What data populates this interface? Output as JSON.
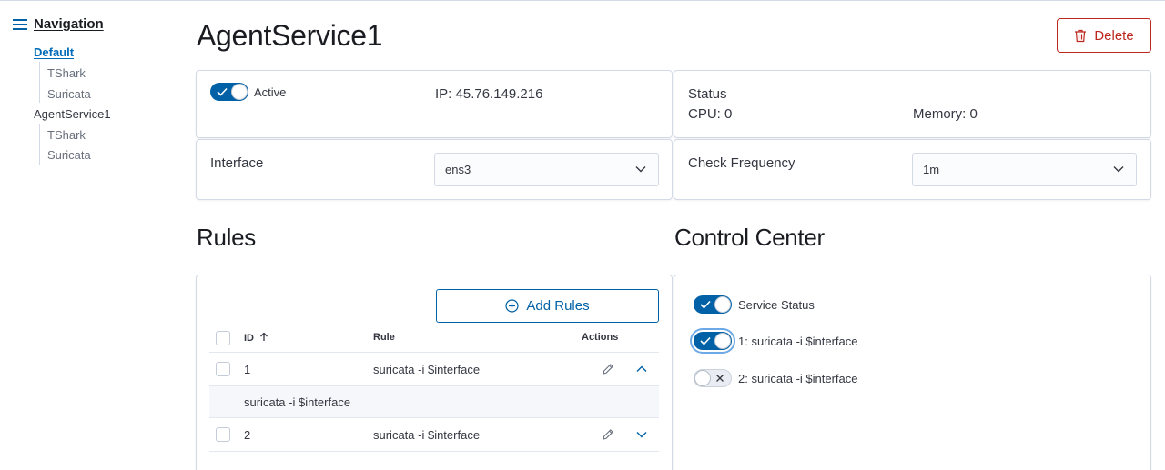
{
  "nav": {
    "title": "Navigation",
    "items": [
      {
        "label": "Default",
        "children": [
          "TShark",
          "Suricata"
        ]
      },
      {
        "label": "AgentService1",
        "children": [
          "TShark",
          "Suricata"
        ]
      }
    ]
  },
  "page": {
    "title": "AgentService1",
    "delete_label": "Delete"
  },
  "info": {
    "active_label": "Active",
    "ip": "IP: 45.76.149.216",
    "status_label": "Status",
    "cpu": "CPU: 0",
    "memory": "Memory: 0"
  },
  "interface": {
    "label": "Interface",
    "value": "ens3"
  },
  "frequency": {
    "label": "Check Frequency",
    "value": "1m"
  },
  "rules": {
    "title": "Rules",
    "add_label": "Add Rules",
    "columns": [
      "ID",
      "Rule",
      "Actions"
    ],
    "rows": [
      {
        "id": "1",
        "rule": "suricata -i $interface",
        "expanded": "suricata -i $interface"
      },
      {
        "id": "2",
        "rule": "suricata -i $interface"
      }
    ]
  },
  "control": {
    "title": "Control Center",
    "service_status": "Service Status",
    "items": [
      "1: suricata -i $interface",
      "2: suricata -i $interface"
    ]
  },
  "colors": {
    "primary": "#0061a6",
    "danger": "#bd271e",
    "link": "#006bb8"
  }
}
